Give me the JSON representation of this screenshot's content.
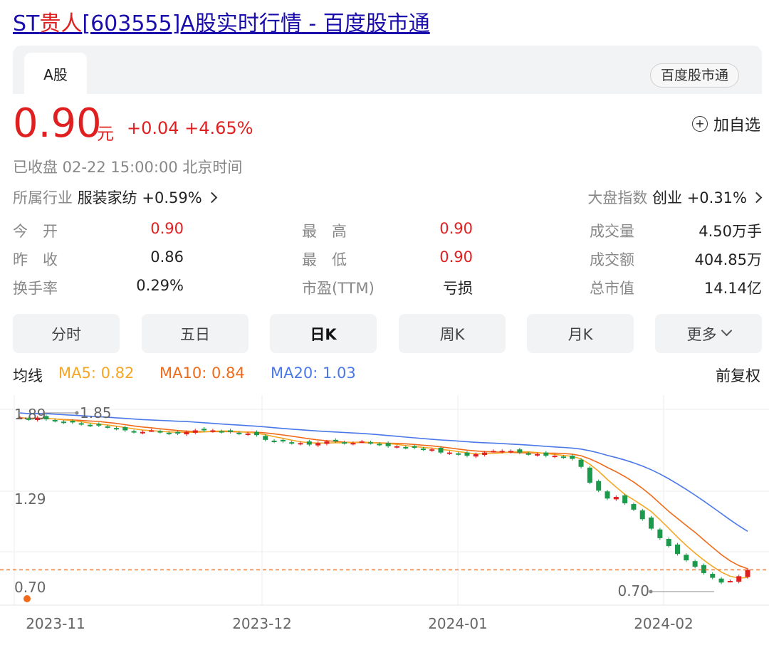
{
  "title_prefix": "ST",
  "title_highlight": "贵人",
  "title_rest": "[603555]A股实时行情 - 百度股市通",
  "tab_a": "A股",
  "badge": "百度股市通",
  "price": "0.90",
  "unit": "元",
  "change": "+0.04 +4.65%",
  "watch_label": "加自选",
  "status": "已收盘  02-22 15:00:00  北京时间",
  "industry_label": "所属行业",
  "industry_value": "服装家纺 +0.59%",
  "index_label": "大盘指数",
  "index_value": "创业 +0.31%",
  "stats": {
    "open_label": "今　开",
    "open": "0.90",
    "prev_label": "昨　收",
    "prev": "0.86",
    "turnover_label": "换手率",
    "turnover": "0.29%",
    "high_label": "最　高",
    "high": "0.90",
    "low_label": "最　低",
    "low": "0.90",
    "pe_label": "市盈(TTM)",
    "pe": "亏损",
    "vol_label": "成交量",
    "vol": "4.50万手",
    "amt_label": "成交额",
    "amt": "404.85万",
    "cap_label": "总市值",
    "cap": "14.14亿"
  },
  "periods": [
    "分时",
    "五日",
    "日K",
    "周K",
    "月K",
    "更多"
  ],
  "ma_label": "均线",
  "ma5": "MA5: 0.82",
  "ma10": "MA10: 0.84",
  "ma20": "MA20: 1.03",
  "adjust": "前复权",
  "colors": {
    "up": "#e02020",
    "down": "#1a9a4a",
    "ma5": "#f5a623",
    "ma10": "#f06a1a",
    "ma20": "#4a78e8"
  },
  "chart_data": {
    "type": "candlestick",
    "y_labels": [
      "1.89",
      "1.29",
      "0.70"
    ],
    "high_marker": "1.85",
    "low_marker": "0.70",
    "x_labels": [
      "2023-11",
      "2023-12",
      "2024-01",
      "2024-02"
    ],
    "last_close": 0.9,
    "closes": [
      1.86,
      1.85,
      1.86,
      1.85,
      1.84,
      1.83,
      1.83,
      1.82,
      1.81,
      1.81,
      1.8,
      1.79,
      1.78,
      1.77,
      1.77,
      1.78,
      1.77,
      1.76,
      1.76,
      1.77,
      1.78,
      1.78,
      1.78,
      1.77,
      1.77,
      1.76,
      1.76,
      1.75,
      1.72,
      1.71,
      1.71,
      1.7,
      1.7,
      1.69,
      1.7,
      1.71,
      1.71,
      1.7,
      1.7,
      1.71,
      1.7,
      1.69,
      1.68,
      1.68,
      1.67,
      1.67,
      1.66,
      1.66,
      1.64,
      1.64,
      1.63,
      1.62,
      1.63,
      1.64,
      1.65,
      1.65,
      1.65,
      1.64,
      1.63,
      1.63,
      1.62,
      1.62,
      1.61,
      1.6,
      1.55,
      1.45,
      1.4,
      1.35,
      1.36,
      1.32,
      1.28,
      1.22,
      1.16,
      1.1,
      1.05,
      1.0,
      0.96,
      0.92,
      0.88,
      0.85,
      0.82,
      0.83,
      0.86,
      0.9
    ]
  }
}
